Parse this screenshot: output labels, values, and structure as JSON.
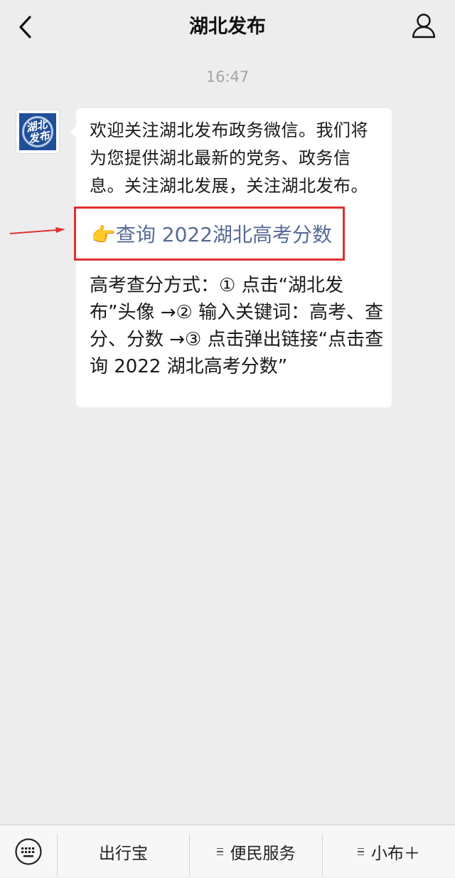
{
  "nav": {
    "title": "湖北发布",
    "back_icon": "chevron-left-icon",
    "profile_icon": "person-icon"
  },
  "chat": {
    "time": "16:47",
    "avatar_logo_text": "湖北发布",
    "welcome": "欢迎关注湖北发布政务微信。我们将为您提供湖北最新的党务、政务信息。关注湖北发展，关注湖北发布。",
    "link_emoji": "👉",
    "link": "查询 2022湖北高考分数",
    "steps": "高考查分方式：① 点击“湖北发布”头像 →② 输入关键词：高考、查分、分数 →③ 点击弹出链接“点击查询 2022 湖北高考分数”",
    "highlight_color": "#e03030",
    "link_color": "#576b95"
  },
  "bottom_bar": {
    "keyboard_icon": "keyboard-icon",
    "menus": [
      {
        "label": "出行宝",
        "has_submenu": false
      },
      {
        "label": "便民服务",
        "has_submenu": true
      },
      {
        "label": "小布＋",
        "has_submenu": true
      }
    ]
  }
}
